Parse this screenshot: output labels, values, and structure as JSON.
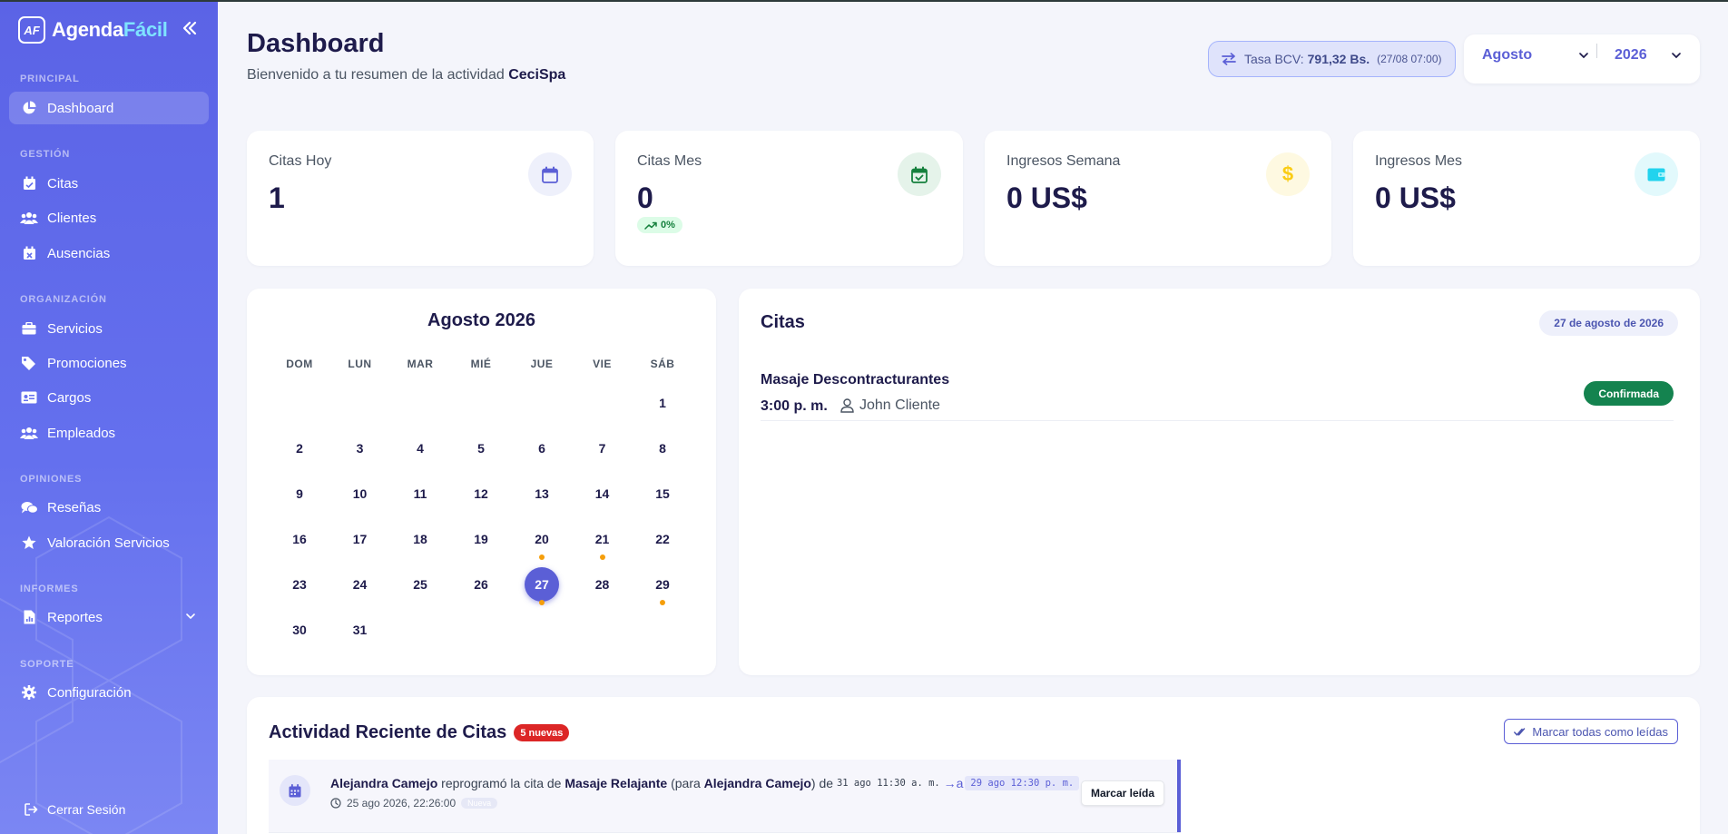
{
  "brand": {
    "logo_text": "AF",
    "name_part1": "Agenda",
    "name_part2": "Fácil"
  },
  "sidebar": {
    "sections": [
      {
        "label": "PRINCIPAL"
      },
      {
        "label": "GESTIÓN"
      },
      {
        "label": "ORGANIZACIÓN"
      },
      {
        "label": "OPINIONES"
      },
      {
        "label": "INFORMES"
      },
      {
        "label": "SOPORTE"
      }
    ],
    "items": [
      {
        "label": "Dashboard",
        "icon": "chart-pie-icon",
        "active": true
      },
      {
        "label": "Citas",
        "icon": "calendar-check-icon"
      },
      {
        "label": "Clientes",
        "icon": "users-icon"
      },
      {
        "label": "Ausencias",
        "icon": "calendar-x-icon"
      },
      {
        "label": "Servicios",
        "icon": "briefcase-icon"
      },
      {
        "label": "Promociones",
        "icon": "tags-icon"
      },
      {
        "label": "Cargos",
        "icon": "id-card-icon"
      },
      {
        "label": "Empleados",
        "icon": "users-icon"
      },
      {
        "label": "Reseñas",
        "icon": "comments-icon"
      },
      {
        "label": "Valoración Servicios",
        "icon": "star-icon"
      },
      {
        "label": "Reportes",
        "icon": "file-chart-icon"
      },
      {
        "label": "Configuración",
        "icon": "gear-icon"
      }
    ],
    "logout_label": "Cerrar Sesión"
  },
  "header": {
    "title": "Dashboard",
    "subtitle_prefix": "Bienvenido a tu resumen de la actividad ",
    "business_name": "CeciSpa",
    "rate_label": "Tasa BCV:",
    "rate_value": "791,32 Bs.",
    "rate_time": "(27/08 07:00)",
    "month_select": "Agosto",
    "year_select": "2026"
  },
  "stats": [
    {
      "label": "Citas Hoy",
      "value": "1",
      "icon": "calendar-icon",
      "color": "#5b5fd6"
    },
    {
      "label": "Citas Mes",
      "value": "0",
      "trend": "0%",
      "icon": "calendar-check-icon",
      "color": "#15803d"
    },
    {
      "label": "Ingresos Semana",
      "value": "0 US$",
      "icon": "dollar-icon",
      "color": "#facc15"
    },
    {
      "label": "Ingresos Mes",
      "value": "0 US$",
      "icon": "wallet-icon",
      "color": "#22d3ee"
    }
  ],
  "calendar": {
    "title": "Agosto 2026",
    "weekdays": [
      "DOM",
      "LUN",
      "MAR",
      "MIÉ",
      "JUE",
      "VIE",
      "SÁB"
    ],
    "first_weekday": 6,
    "days_in_month": 31,
    "selected_day": 27,
    "dot_days": [
      20,
      21,
      27,
      29
    ]
  },
  "appointments": {
    "title": "Citas",
    "date": "27 de agosto de 2026",
    "items": [
      {
        "service": "Masaje Descontracturantes",
        "time": "3:00 p. m.",
        "client": "John Cliente",
        "status": "Confirmada"
      }
    ]
  },
  "activity": {
    "title": "Actividad Reciente de Citas",
    "new_count": "5 nuevas",
    "mark_all_label": "Marcar todas como leídas",
    "items": [
      {
        "actor": "Alejandra Camejo",
        "action": "reprogramó la cita de",
        "service": "Masaje Relajante",
        "for_prefix": "(para",
        "for_name": "Alejandra Camejo",
        "for_suffix": ") de",
        "from": "31 ago 11:30 a. m.",
        "arrow": "→a",
        "to": "29 ago 12:30 p. m.",
        "timestamp": "25 ago 2026, 22:26:00",
        "badge": "Nueva",
        "button": "Marcar leída"
      }
    ]
  }
}
